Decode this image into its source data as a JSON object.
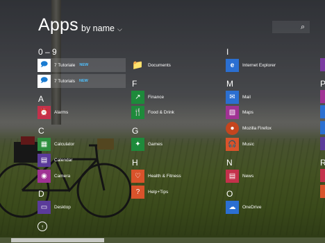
{
  "header": {
    "title": "Apps",
    "sort_label": "by name",
    "sort_icon": "chevron-down-icon"
  },
  "search": {
    "icon": "search-icon"
  },
  "sections": {
    "num": "0 – 9",
    "a": "A",
    "c": "C",
    "d": "D",
    "f": "F",
    "g": "G",
    "h": "H",
    "i": "I",
    "m": "M",
    "n": "N",
    "o": "O",
    "p": "P",
    "r": "R"
  },
  "apps": {
    "tutoriale1": {
      "label": "7 Tutoriale",
      "badge": "NEW",
      "color": "#ffffff"
    },
    "tutoriale2": {
      "label": "7 Tutorials",
      "badge": "NEW",
      "color": "#ffffff"
    },
    "alarms": {
      "label": "Alarms",
      "color": "#c4314b"
    },
    "calculator": {
      "label": "Calculator",
      "color": "#2f8f3f"
    },
    "calendar": {
      "label": "Calendar",
      "color": "#5b3b9a"
    },
    "camera": {
      "label": "Camera",
      "color": "#a03294"
    },
    "desktop": {
      "label": "Desktop",
      "color": "#5b3b9a"
    },
    "documents": {
      "label": "Documents",
      "color": "#d8b04a"
    },
    "finance": {
      "label": "Finance",
      "color": "#1e8a3b"
    },
    "food": {
      "label": "Food & Drink",
      "color": "#1e8a3b"
    },
    "games": {
      "label": "Games",
      "color": "#1e8a3b"
    },
    "health": {
      "label": "Health & Fitness",
      "color": "#d9532b"
    },
    "help": {
      "label": "Help+Tips",
      "color": "#d9532b"
    },
    "ie": {
      "label": "Internet Explorer",
      "color": "#2b6fd1"
    },
    "mail": {
      "label": "Mail",
      "color": "#2b6fd1"
    },
    "maps": {
      "label": "Maps",
      "color": "#a03294"
    },
    "firefox": {
      "label": "Mozilla Firefox",
      "color": "#c4451e"
    },
    "music": {
      "label": "Music",
      "color": "#d9532b"
    },
    "news": {
      "label": "News",
      "color": "#c4314b"
    },
    "onedrive": {
      "label": "OneDrive",
      "color": "#2b6fd1"
    }
  },
  "footer": {
    "scroll_up_icon": "arrow-up-icon"
  }
}
